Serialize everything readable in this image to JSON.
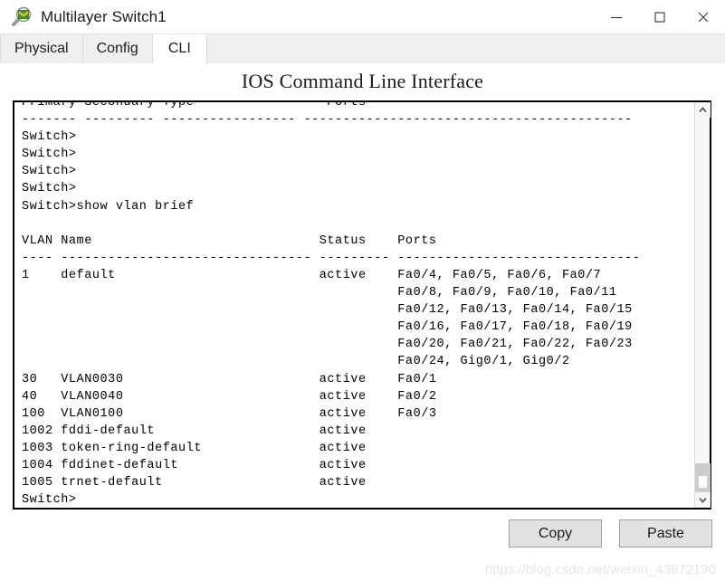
{
  "window": {
    "title": "Multilayer Switch1",
    "icon": "packet-tracer-icon",
    "controls": {
      "minimize": "minimize-icon",
      "maximize": "maximize-icon",
      "close": "close-icon"
    }
  },
  "tabs": [
    {
      "label": "Physical",
      "active": false
    },
    {
      "label": "Config",
      "active": false
    },
    {
      "label": "CLI",
      "active": true
    }
  ],
  "cli": {
    "heading": "IOS Command Line Interface",
    "lines": [
      "Primary Secondary Type                 Ports",
      "------- --------- ----------------- ------------------------------------------",
      "Switch>",
      "Switch>",
      "Switch>",
      "Switch>",
      "Switch>show vlan brief",
      "",
      "VLAN Name                             Status    Ports",
      "---- -------------------------------- --------- -------------------------------",
      "1    default                          active    Fa0/4, Fa0/5, Fa0/6, Fa0/7",
      "                                                Fa0/8, Fa0/9, Fa0/10, Fa0/11",
      "                                                Fa0/12, Fa0/13, Fa0/14, Fa0/15",
      "                                                Fa0/16, Fa0/17, Fa0/18, Fa0/19",
      "                                                Fa0/20, Fa0/21, Fa0/22, Fa0/23",
      "                                                Fa0/24, Gig0/1, Gig0/2",
      "30   VLAN0030                         active    Fa0/1",
      "40   VLAN0040                         active    Fa0/2",
      "100  VLAN0100                         active    Fa0/3",
      "1002 fddi-default                     active",
      "1003 token-ring-default               active",
      "1004 fddinet-default                  active",
      "1005 trnet-default                    active",
      "Switch>"
    ]
  },
  "scrollbar": {
    "up_arrow": "chevron-up-icon",
    "down_arrow": "chevron-down-icon"
  },
  "buttons": {
    "copy": "Copy",
    "paste": "Paste"
  },
  "watermark": "https://blog.csdn.net/weixin_43872190"
}
